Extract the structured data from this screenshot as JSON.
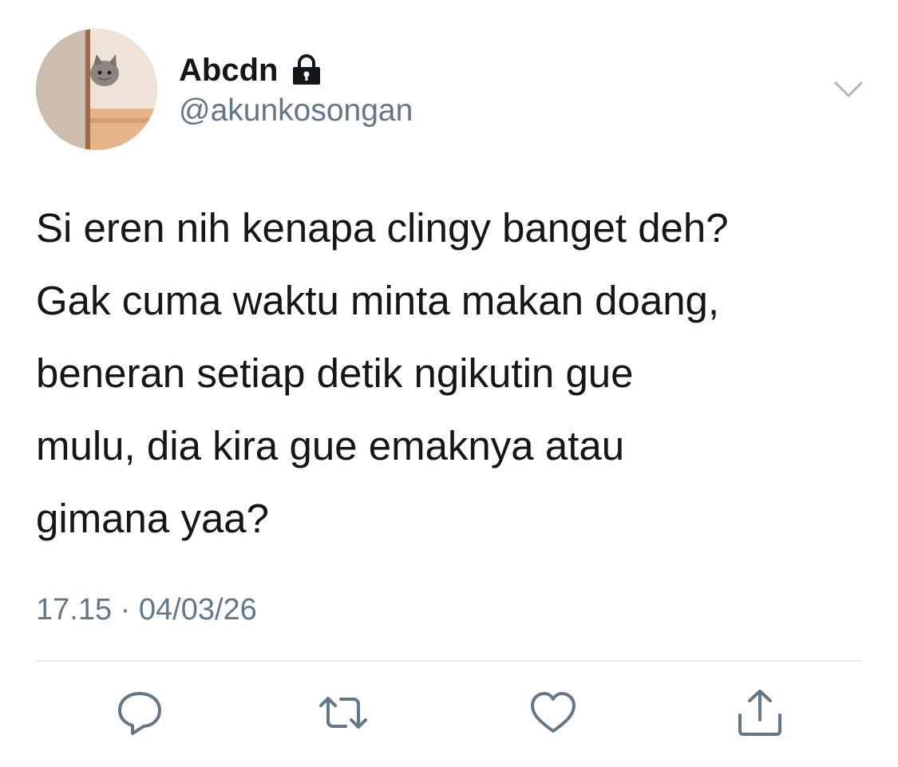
{
  "tweet": {
    "author": {
      "display_name": "Abcdn",
      "handle": "@akunkosongan",
      "avatar_icon": "avatar-cat-peeking",
      "protected_icon": "lock-icon"
    },
    "text": "Si eren nih kenapa clingy banget deh?\nGak cuma waktu minta makan doang,\nbeneran setiap detik ngikutin gue\nmulu, dia kira gue emaknya atau\ngimana yaa?",
    "timestamp": "17.15 · 04/03/26",
    "menu_icon": "chevron-down-icon",
    "actions": {
      "reply_icon": "reply-icon",
      "retweet_icon": "retweet-icon",
      "like_icon": "heart-icon",
      "share_icon": "share-icon"
    }
  },
  "colors": {
    "text": "#14171a",
    "secondary": "#657786",
    "divider": "#e6ecf0",
    "icon": "#657786"
  }
}
